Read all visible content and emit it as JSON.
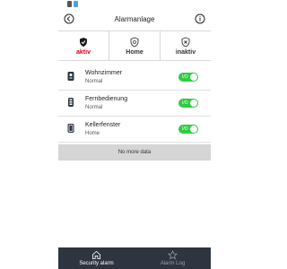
{
  "header": {
    "title": "Alarmanlage",
    "back_icon": "back-circle-icon",
    "info_icon": "info-circle-icon"
  },
  "status_bar": {
    "icons": [
      "notification-icon",
      "wifi-icon"
    ]
  },
  "tabs": [
    {
      "label": "aktiv",
      "icon": "shield-check-icon",
      "active": true
    },
    {
      "label": "Home",
      "icon": "shield-home-icon",
      "active": false
    },
    {
      "label": "inaktiv",
      "icon": "shield-x-icon",
      "active": false
    }
  ],
  "devices": [
    {
      "name": "Wohnzimmer",
      "mode": "Normal",
      "icon": "motion-sensor-icon",
      "enabled": true
    },
    {
      "name": "Fernbedienung",
      "mode": "Normal",
      "icon": "remote-control-icon",
      "enabled": true
    },
    {
      "name": "Kellerfenster",
      "mode": "Home",
      "icon": "door-sensor-icon",
      "enabled": true
    }
  ],
  "toggle_on_text": "I/O",
  "no_more_text": "No more data",
  "bottom_nav": [
    {
      "label": "Security alarm",
      "icon": "home-icon",
      "active": true
    },
    {
      "label": "Alarm Log",
      "icon": "star-icon",
      "active": false
    }
  ],
  "colors": {
    "active_tab": "#d0021b",
    "toggle_on": "#2ecc40",
    "bottom_nav_bg": "#2e3540",
    "no_more_bg": "#d5d5d5"
  }
}
